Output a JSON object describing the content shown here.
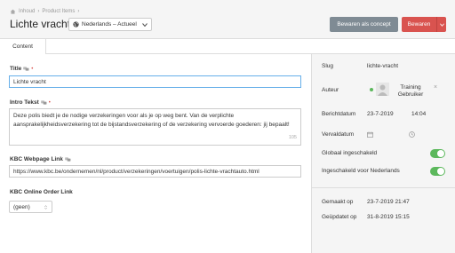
{
  "breadcrumb": {
    "items": [
      "Inhoud",
      "Product Items"
    ],
    "sep": "›"
  },
  "page_title": "Lichte vracht",
  "language_select": {
    "value": "Nederlands – Actueel"
  },
  "buttons": {
    "concept": "Bewaren als concept",
    "save": "Bewaren"
  },
  "tabs": [
    {
      "label": "Content"
    }
  ],
  "form": {
    "title_label": "Title",
    "title_value": "Lichte vracht",
    "intro_label": "Intro Tekst",
    "intro_value": "Deze polis biedt je de nodige verzekeringen voor als je op weg bent. Van de verplichte aansprakelijkheidsverzekering tot de bijstandsverzekering of de verzekering vervoerde goederen: jij bepaalt!",
    "intro_count": "105",
    "webpage_label": "KBC Webpage Link",
    "webpage_value": "https://www.kbc.be/ondernemen/nl/product/verzekeringen/voertuigen/polis-lichte-vrachtauto.html",
    "order_label": "KBC Online Order Link",
    "order_value": "(geen)",
    "required_mark": "•"
  },
  "sidebar": {
    "slug_label": "Slug",
    "slug_value": "lichte-vracht",
    "author_label": "Auteur",
    "author_name": "Training Gebruiker",
    "author_remove": "×",
    "date_label": "Berichtdatum",
    "date_value": "23-7-2019",
    "time_value": "14:04",
    "expiry_label": "Vervaldatum",
    "global_label": "Globaal ingeschakeld",
    "global_on": true,
    "nl_label": "Ingeschakeld voor Nederlands",
    "nl_on": true,
    "created_label": "Gemaakt op",
    "created_value": "23-7-2019 21:47",
    "updated_label": "Geüpdatet op",
    "updated_value": "31-8-2019 15:15"
  },
  "colors": {
    "save": "#d9534f",
    "concept": "#7f8b94",
    "toggle_on": "#5cb85c",
    "required": "#d9534f"
  }
}
